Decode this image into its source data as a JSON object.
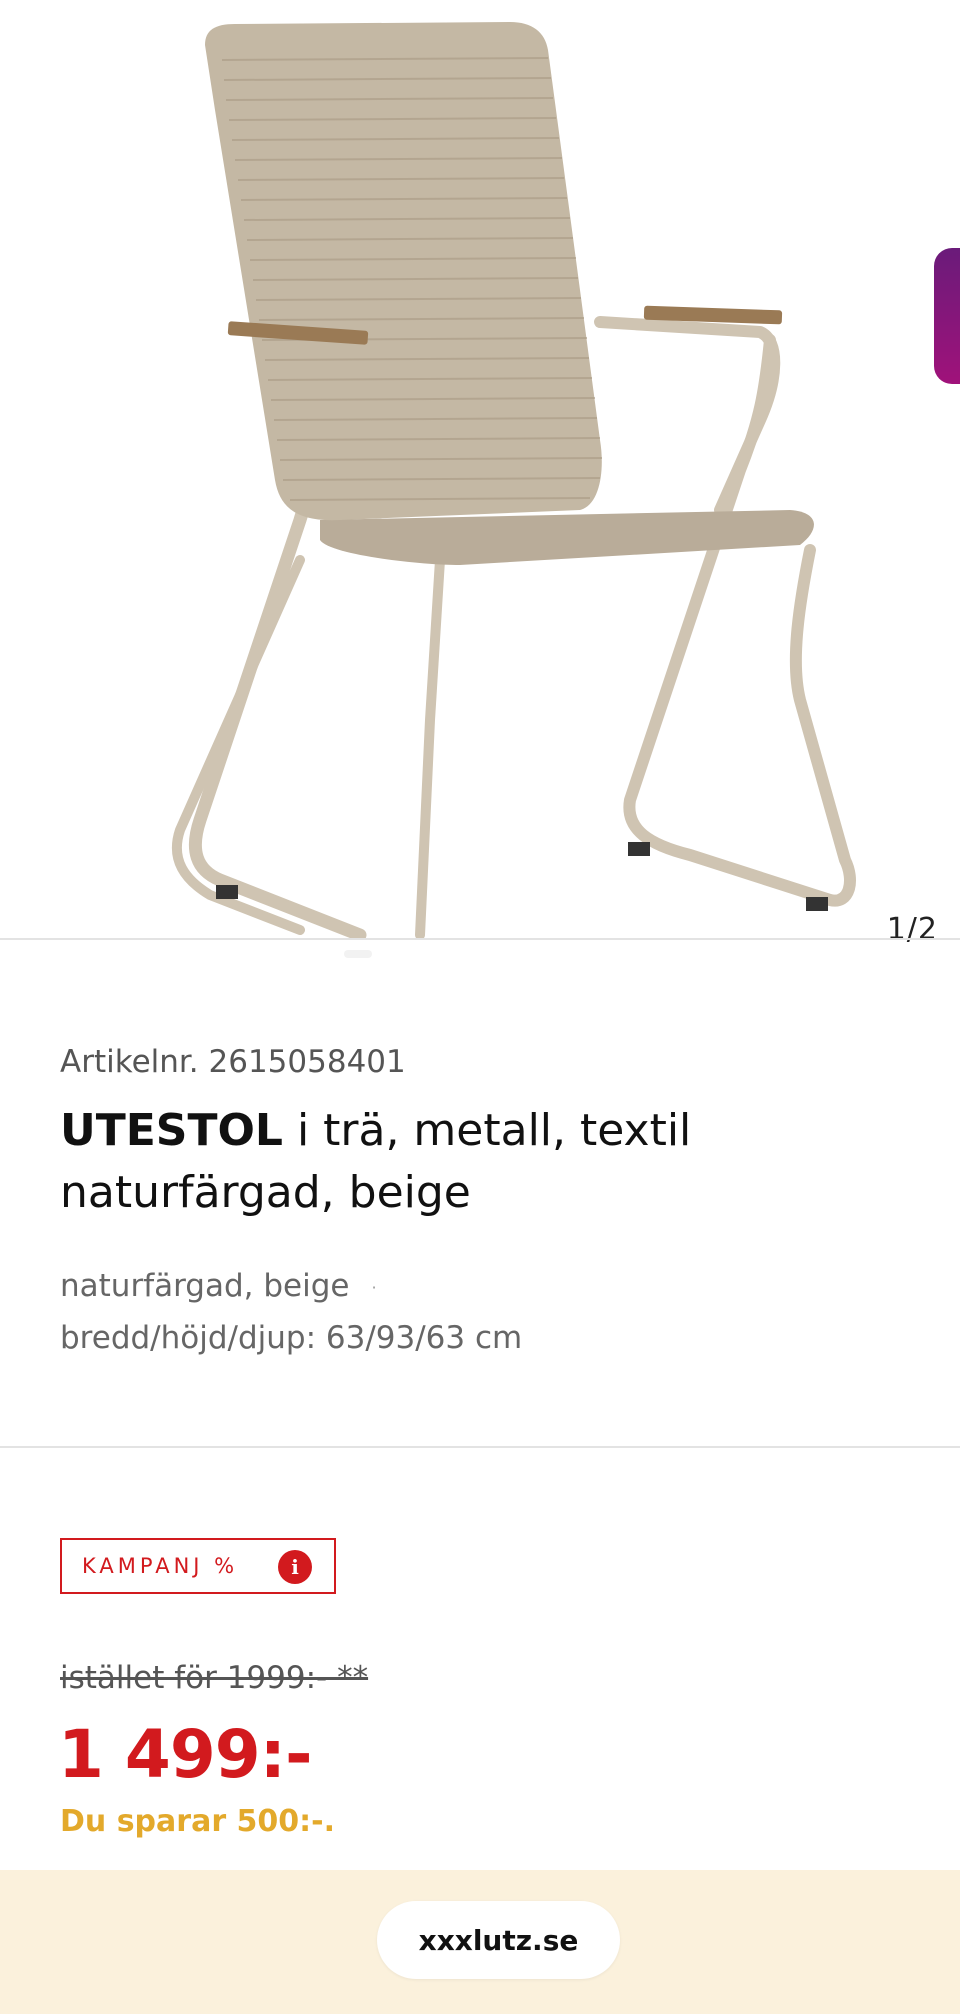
{
  "gallery": {
    "image_alt": "Utestol, naturfärgad, beige",
    "counter": "1/2"
  },
  "product": {
    "article_number": "Artikelnr. 2615058401",
    "name_bold": "UTESTOL",
    "name_rest": " i trä, metall, textil",
    "name_line2": "naturfärgad, beige",
    "variant": "naturfärgad, beige",
    "variant_separator": "·",
    "dimensions": "bredd/höjd/djup: 63/93/63 cm"
  },
  "pricing": {
    "campaign_label": "KAMPANJ %",
    "info_icon_glyph": "i",
    "old_price": "istället för 1999:- **",
    "price": "1 499:-",
    "savings": "Du sparar 500:-."
  },
  "browser": {
    "url": "xxxlutz.se"
  },
  "colors": {
    "accent_red": "#d21a1e",
    "savings_yellow": "#e3a92b",
    "bottom_bar_bg": "#fbf1dc"
  },
  "icons": {
    "info": "info-icon"
  }
}
